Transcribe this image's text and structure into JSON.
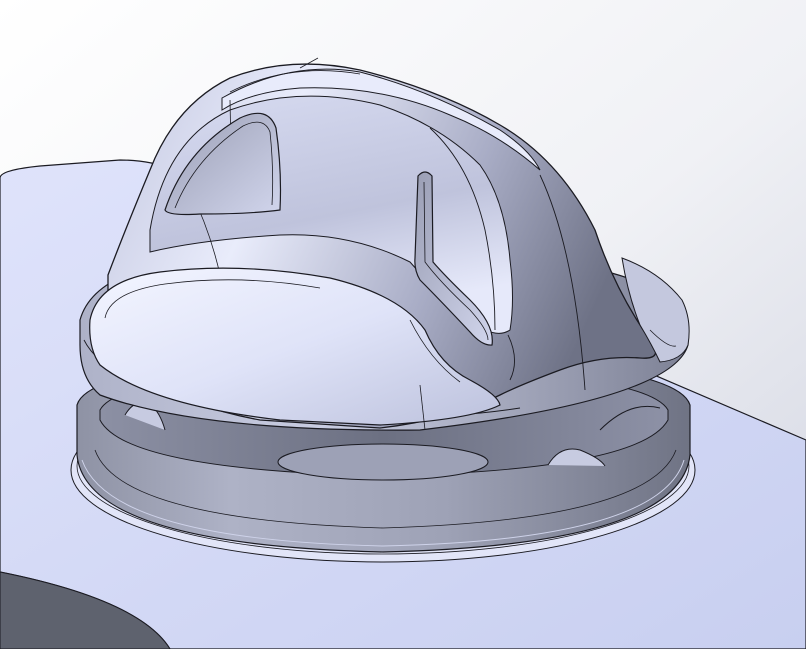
{
  "viewport": {
    "background_top": "#ffffff",
    "background_bottom": "#d6d9e6"
  },
  "colors": {
    "edge": "#1b1b22",
    "plate_top": "#d3d8f3",
    "plate_side": "#5e626e",
    "body_light": "#eef0fb",
    "body_mid": "#b9bdd6",
    "body_dark": "#7d8196",
    "ring_dark": "#777b8a"
  }
}
